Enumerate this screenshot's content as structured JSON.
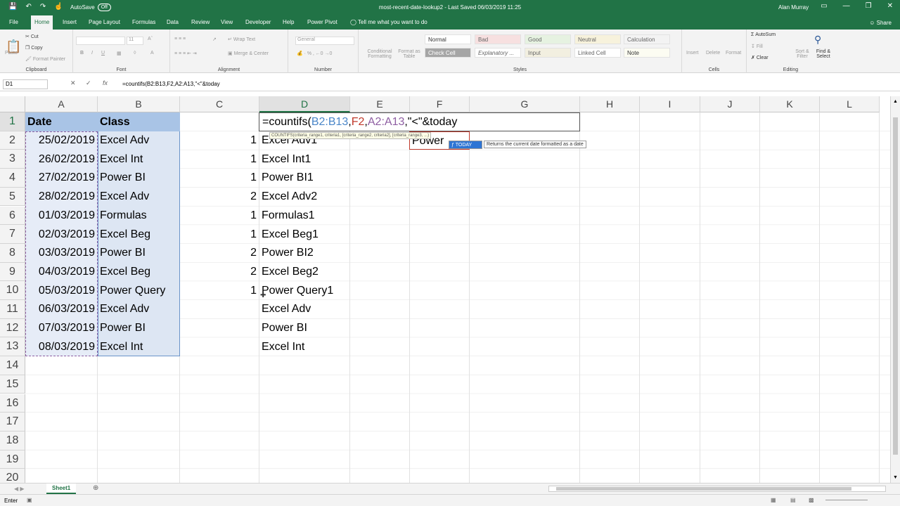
{
  "titlebar": {
    "autosave_label": "AutoSave",
    "autosave_state": "Off",
    "document_title": "most-recent-date-lookup2 - Last Saved 06/03/2019 11:25",
    "user": "Alan Murray"
  },
  "menu": {
    "tabs": [
      "File",
      "Home",
      "Insert",
      "Page Layout",
      "Formulas",
      "Data",
      "Review",
      "View",
      "Developer",
      "Help",
      "Power Pivot"
    ],
    "tell_me": "Tell me what you want to do",
    "share": "Share",
    "active_tab": "Home"
  },
  "ribbon": {
    "clipboard": {
      "paste": "Paste",
      "cut": "Cut",
      "copy": "Copy",
      "format_painter": "Format Painter",
      "label": "Clipboard"
    },
    "font": {
      "size": "11",
      "label": "Font"
    },
    "alignment": {
      "wrap": "Wrap Text",
      "merge": "Merge & Center",
      "label": "Alignment"
    },
    "number": {
      "format": "General",
      "label": "Number"
    },
    "styles": {
      "conditional": "Conditional Formatting",
      "format_table": "Format as Table",
      "normal": "Normal",
      "bad": "Bad",
      "good": "Good",
      "neutral": "Neutral",
      "calculation": "Calculation",
      "check_cell": "Check Cell",
      "explanatory": "Explanatory ...",
      "input": "Input",
      "linked_cell": "Linked Cell",
      "note": "Note",
      "label": "Styles"
    },
    "cells": {
      "insert": "Insert",
      "delete": "Delete",
      "format": "Format",
      "label": "Cells"
    },
    "editing": {
      "autosum": "AutoSum",
      "fill": "Fill",
      "clear": "Clear",
      "sort": "Sort & Filter",
      "find": "Find & Select",
      "label": "Editing"
    }
  },
  "formula_bar": {
    "name_box": "D1",
    "formula": "=countifs(B2:B13,F2,A2:A13,\"<\"&today"
  },
  "columns": [
    "A",
    "B",
    "C",
    "D",
    "E",
    "F",
    "G",
    "H",
    "I",
    "J",
    "K",
    "L"
  ],
  "rows": [
    "1",
    "2",
    "3",
    "4",
    "5",
    "6",
    "7",
    "8",
    "9",
    "10",
    "11",
    "12",
    "13",
    "14",
    "15",
    "16",
    "17",
    "18",
    "19",
    "20"
  ],
  "header": {
    "a": "Date",
    "b": "Class"
  },
  "data": [
    {
      "date": "25/02/2019",
      "class": "Excel Adv",
      "c": "1",
      "d": "Excel Adv1"
    },
    {
      "date": "26/02/2019",
      "class": "Excel Int",
      "c": "1",
      "d": "Excel Int1"
    },
    {
      "date": "27/02/2019",
      "class": "Power BI",
      "c": "1",
      "d": "Power BI1"
    },
    {
      "date": "28/02/2019",
      "class": "Excel Adv",
      "c": "2",
      "d": "Excel Adv2"
    },
    {
      "date": "01/03/2019",
      "class": "Formulas",
      "c": "1",
      "d": "Formulas1"
    },
    {
      "date": "02/03/2019",
      "class": "Excel Beg",
      "c": "1",
      "d": "Excel Beg1"
    },
    {
      "date": "03/03/2019",
      "class": "Power BI",
      "c": "2",
      "d": "Power BI2"
    },
    {
      "date": "04/03/2019",
      "class": "Excel Beg",
      "c": "2",
      "d": "Excel Beg2"
    },
    {
      "date": "05/03/2019",
      "class": "Power Query",
      "c": "1",
      "d": "Power Query1"
    },
    {
      "date": "06/03/2019",
      "class": "Excel Adv",
      "c": "",
      "d": "Excel Adv"
    },
    {
      "date": "07/03/2019",
      "class": "Power BI",
      "c": "",
      "d": "Power BI"
    },
    {
      "date": "08/03/2019",
      "class": "Excel Int",
      "c": "",
      "d": "Excel Int"
    }
  ],
  "edit_cell": {
    "prefix": "=countifs(",
    "ref1": "B2:B13",
    "comma1": ",",
    "ref2": "F2",
    "comma2": ",",
    "ref3": "A2:A13",
    "suffix": ",\"<\"&today"
  },
  "tooltip": {
    "syntax": "COUNTIFS(criteria_range1, criteria1, [criteria_range2, criteria2], [criteria_range3, ...)",
    "autocomplete": "TODAY",
    "description": "Returns the current date formatted as a date"
  },
  "f2_value": "Power",
  "sheet_tab": "Sheet1",
  "status": "Enter",
  "colors": {
    "accent": "#217346",
    "ref_blue": "#4a86c8",
    "ref_red": "#c0392b",
    "ref_purple": "#8e5ea2"
  }
}
